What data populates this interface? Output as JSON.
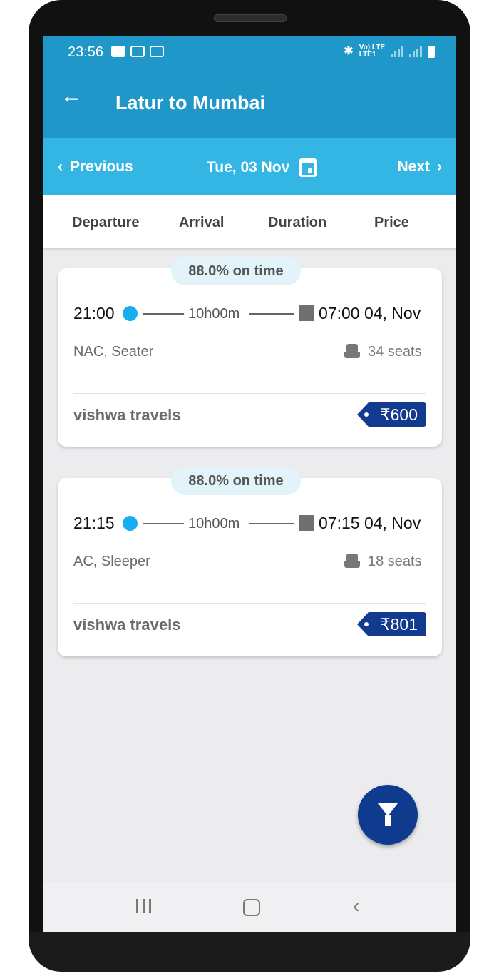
{
  "status_bar": {
    "time": "23:56",
    "left_icons": [
      "youtube-icon",
      "app-icon",
      "wifi-icon"
    ],
    "right_icons": [
      "bluetooth-icon",
      "volte-icon",
      "signal-icon",
      "battery-icon"
    ],
    "volte_text": "Vo) LTE",
    "lte_text": "LTE1"
  },
  "app_bar": {
    "back_icon": "arrow-left-icon",
    "title": "Latur to Mumbai",
    "color": "#1f97c8"
  },
  "date_bar": {
    "previous_label": "Previous",
    "date_label": "Tue, 03 Nov",
    "next_label": "Next",
    "color": "#33b6e4"
  },
  "sort_options": [
    "Departure",
    "Arrival",
    "Duration",
    "Price"
  ],
  "buses": [
    {
      "on_time": "88.0% on time",
      "departure": "21:00",
      "duration": "10h00m",
      "arrival": "07:00 04, Nov",
      "type": "NAC, Seater",
      "seats": "34 seats",
      "operator": "vishwa travels",
      "price": "₹600"
    },
    {
      "on_time": "88.0% on time",
      "departure": "21:15",
      "duration": "10h00m",
      "arrival": "07:15 04, Nov",
      "type": "AC, Sleeper",
      "seats": "18 seats",
      "operator": "vishwa travels",
      "price": "₹801"
    }
  ],
  "fab": {
    "icon": "filter-icon",
    "color": "#0f3a8d"
  },
  "nav_bar": {
    "icons": [
      "recents-icon",
      "home-icon",
      "back-icon"
    ]
  }
}
